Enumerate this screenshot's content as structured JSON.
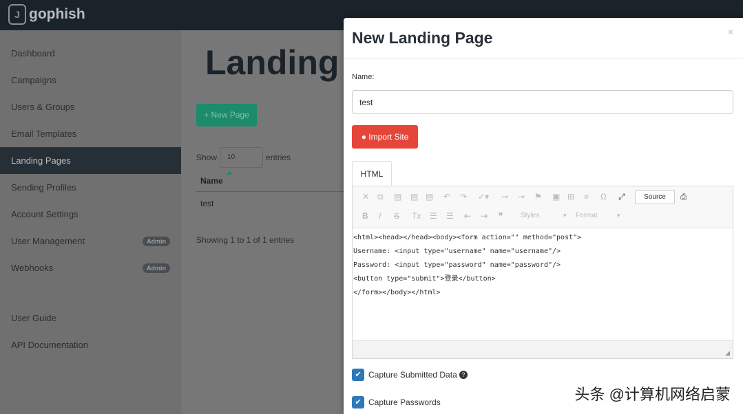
{
  "brand": "gophish",
  "sidebar": {
    "items": [
      {
        "label": "Dashboard"
      },
      {
        "label": "Campaigns"
      },
      {
        "label": "Users & Groups"
      },
      {
        "label": "Email Templates"
      },
      {
        "label": "Landing Pages",
        "active": true
      },
      {
        "label": "Sending Profiles"
      },
      {
        "label": "Account Settings"
      },
      {
        "label": "User Management",
        "badge": "Admin"
      },
      {
        "label": "Webhooks",
        "badge": "Admin"
      },
      {
        "label": "User Guide"
      },
      {
        "label": "API Documentation"
      }
    ]
  },
  "main": {
    "title": "Landing Pages",
    "new_button": "+ New Page",
    "show_label": "Show",
    "entries_value": "10",
    "entries_label": "entries",
    "column_name": "Name",
    "rows": [
      "test"
    ],
    "info": "Showing 1 to 1 of 1 entries"
  },
  "modal": {
    "title": "New Landing Page",
    "close": "×",
    "name_label": "Name:",
    "name_value": "test",
    "import_button": "Import Site",
    "tab": "HTML",
    "source_button": "Source",
    "styles_placeholder": "Styles",
    "format_placeholder": "Format",
    "code_lines": [
      "<html><head></head><body><form action=\"\" method=\"post\">",
      "Username: <input type=\"username\" name=\"username\"/>",
      "Password: <input type=\"password\" name=\"password\"/>",
      "<button type=\"submit\">登录</button>",
      "</form></body></html>"
    ],
    "capture_data": "Capture Submitted Data",
    "capture_data_checked": true,
    "capture_passwords": "Capture Passwords",
    "capture_passwords_checked": true
  },
  "watermark": "头条 @计算机网络启蒙",
  "colors": {
    "topbar": "#1b232a",
    "accent_green": "#1d8a6a",
    "import_red": "#e6463a",
    "checkbox_blue": "#2f78b8"
  }
}
